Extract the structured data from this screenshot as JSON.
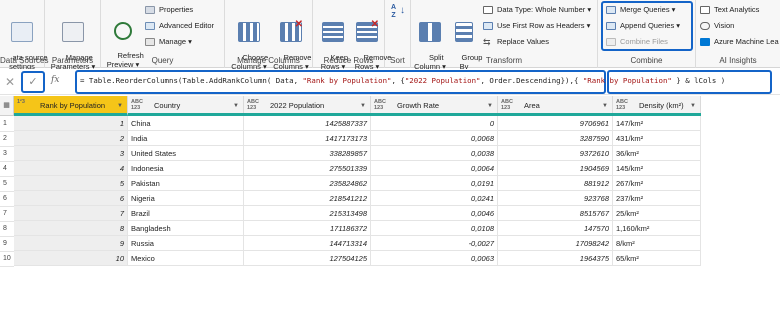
{
  "ribbon": {
    "groups": {
      "data_sources": "Data Sources",
      "parameters": "Parameters",
      "query": "Query",
      "manage_columns": "Manage Columns",
      "reduce_rows": "Reduce Rows",
      "sort": "Sort",
      "transform": "Transform",
      "combine": "Combine",
      "ai_insights": "AI Insights"
    },
    "data_source_settings": "ata source\nsettings",
    "manage_parameters": "Manage\nParameters ▾",
    "refresh_preview": "Refresh\nPreview ▾",
    "properties": "Properties",
    "advanced_editor": "Advanced Editor",
    "manage": "Manage ▾",
    "choose_columns": "Choose\nColumns ▾",
    "remove_columns": "Remove\nColumns ▾",
    "keep_rows": "Keep\nRows ▾",
    "remove_rows": "Remove\nRows ▾",
    "split_column": "Split\nColumn ▾",
    "group_by": "Group\nBy",
    "data_type": "Data Type: Whole Number ▾",
    "use_first_row": "Use First Row as Headers ▾",
    "replace_values": "Replace Values",
    "merge_queries": "Merge Queries ▾",
    "append_queries": "Append Queries ▾",
    "combine_files": "Combine Files",
    "text_analytics": "Text Analytics",
    "vision": "Vision",
    "azure_ml": "Azure Machine Lea"
  },
  "formula": {
    "text_a": "= Table.ReorderColumns(",
    "text_b": "Table.AddRankColumn( Data, ",
    "str1": "\"Rank by Population\"",
    "text_c": ", {",
    "str2": "\"2022 Population\"",
    "text_d": ", Order.Descending}),",
    "text_e": "{ ",
    "str3": "\"Rank by Population\"",
    "text_f": " } & lCols )"
  },
  "table": {
    "columns": [
      {
        "type": "1²3",
        "label": "Rank by Population"
      },
      {
        "type": "ABC\n123",
        "label": "Country"
      },
      {
        "type": "ABC\n123",
        "label": "2022 Population"
      },
      {
        "type": "ABC\n123",
        "label": "Growth Rate"
      },
      {
        "type": "ABC\n123",
        "label": "Area"
      },
      {
        "type": "ABC\n123",
        "label": "Density (km²)"
      }
    ],
    "rows": [
      [
        "1",
        "China",
        "1425887337",
        "0",
        "9706961",
        "147/km²"
      ],
      [
        "2",
        "India",
        "1417173173",
        "0,0068",
        "3287590",
        "431/km²"
      ],
      [
        "3",
        "United States",
        "338289857",
        "0,0038",
        "9372610",
        "36/km²"
      ],
      [
        "4",
        "Indonesia",
        "275501339",
        "0,0064",
        "1904569",
        "145/km²"
      ],
      [
        "5",
        "Pakistan",
        "235824862",
        "0,0191",
        "881912",
        "267/km²"
      ],
      [
        "6",
        "Nigeria",
        "218541212",
        "0,0241",
        "923768",
        "237/km²"
      ],
      [
        "7",
        "Brazil",
        "215313498",
        "0,0046",
        "8515767",
        "25/km²"
      ],
      [
        "8",
        "Bangladesh",
        "171186372",
        "0,0108",
        "147570",
        "1,160/km²"
      ],
      [
        "9",
        "Russia",
        "144713314",
        "-0,0027",
        "17098242",
        "8/km²"
      ],
      [
        "10",
        "Mexico",
        "127504125",
        "0,0063",
        "1964375",
        "65/km²"
      ]
    ]
  }
}
